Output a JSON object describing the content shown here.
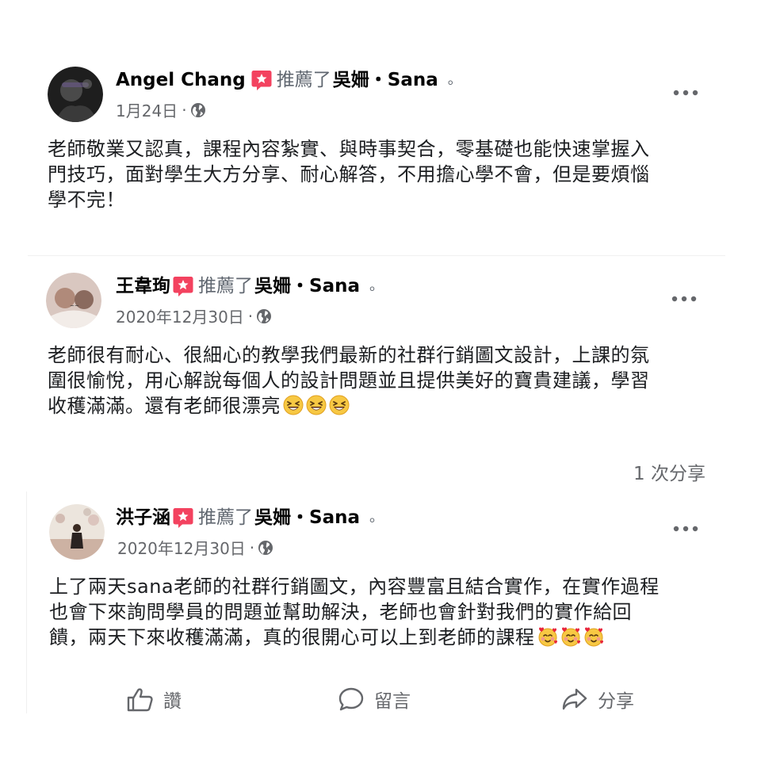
{
  "recommend_text": "推薦了",
  "page_name": "吳姍・Sana",
  "end_mark": "。",
  "meta_sep": "·",
  "icons": {
    "recommend_badge": "star-speech-bubble-icon",
    "privacy": "globe-icon",
    "more": "more-options-icon"
  },
  "colors": {
    "badge": "#f3425f",
    "muted": "#65676b",
    "text": "#1c1e21"
  },
  "posts": [
    {
      "author": "Angel Chang",
      "date": "1月24日",
      "lines": [
        "老師敬業又認真，課程內容紮實、與時事契合，零基礎也能快速掌握入",
        "門技巧，面對學生大方分享、耐心解答，不用擔心學不會，但是要煩惱",
        "學不完！"
      ]
    },
    {
      "author": "王韋珣",
      "date": "2020年12月30日",
      "lines": [
        "老師很有耐心、很細心的教學我們最新的社群行銷圖文設計，上課的氛",
        "圍很愉悅，用心解說每個人的設計問題並且提供美好的寶貴建議，學習",
        "收穫滿滿。還有老師很漂亮"
      ],
      "emoji": "grinning-squinting-face-emoji"
    },
    {
      "author": "洪子涵",
      "date": "2020年12月30日",
      "lines": [
        "上了兩天sana老師的社群行銷圖文，內容豐富且結合實作，在實作過程",
        "也會下來詢問學員的問題並幫助解決，老師也會針對我們的實作給回",
        "饋，兩天下來收穫滿滿，真的很開心可以上到老師的課程"
      ],
      "emoji": "smiling-face-with-hearts-emoji"
    }
  ],
  "share_count": "1 次分享",
  "actions": {
    "like": "讚",
    "comment": "留言",
    "share": "分享"
  }
}
